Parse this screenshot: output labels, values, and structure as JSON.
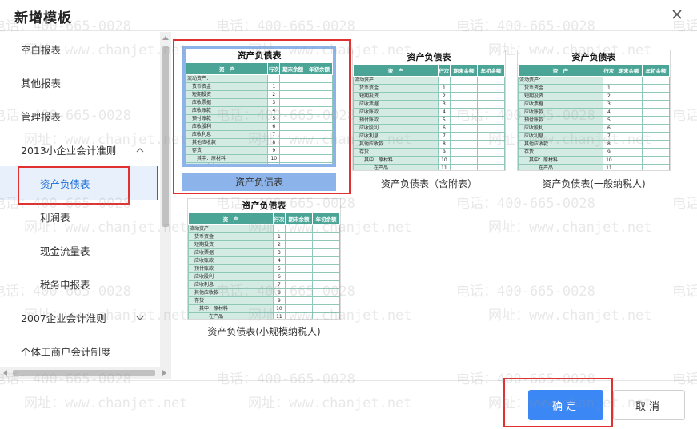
{
  "dialog": {
    "title": "新增模板"
  },
  "sidebar": {
    "items": [
      {
        "label": "空白报表"
      },
      {
        "label": "其他报表"
      },
      {
        "label": "管理报表"
      },
      {
        "label": "2013小企业会计准则"
      },
      {
        "label": "资产负债表"
      },
      {
        "label": "利润表"
      },
      {
        "label": "现金流量表"
      },
      {
        "label": "税务申报表"
      },
      {
        "label": "2007企业会计准则"
      },
      {
        "label": "个体工商户会计制度"
      }
    ]
  },
  "sheet": {
    "title": "资产负债表",
    "headers": [
      "资　产",
      "行次",
      "期末余额",
      "年初余额"
    ],
    "rows": [
      {
        "name": "流动资产：",
        "no": ""
      },
      {
        "name": "　货币资金",
        "no": "1"
      },
      {
        "name": "　短期投资",
        "no": "2"
      },
      {
        "name": "　应收票据",
        "no": "3"
      },
      {
        "name": "　应收账款",
        "no": "4"
      },
      {
        "name": "　预付账款",
        "no": "5"
      },
      {
        "name": "　应收股利",
        "no": "6"
      },
      {
        "name": "　应收利息",
        "no": "7"
      },
      {
        "name": "　其他应收款",
        "no": "8"
      },
      {
        "name": "　存货",
        "no": "9"
      },
      {
        "name": "　　其中：原材料",
        "no": "10"
      },
      {
        "name": "　　　　在产品",
        "no": "11"
      }
    ]
  },
  "templates": [
    {
      "caption": "资产负债表"
    },
    {
      "caption": "资产负债表（含附表）"
    },
    {
      "caption": "资产负债表(一般纳税人)"
    },
    {
      "caption": "资产负债表(小规模纳税人)"
    }
  ],
  "footer": {
    "ok_label": "确定",
    "cancel_label": "取消"
  },
  "watermark": {
    "phone": "电话：400-665-0028",
    "site": "网址：www.chanjet.net"
  },
  "colors": {
    "accent": "#3b87f5",
    "highlight": "#e03030",
    "table_header": "#4aa596",
    "selected": "#8db4ea"
  }
}
